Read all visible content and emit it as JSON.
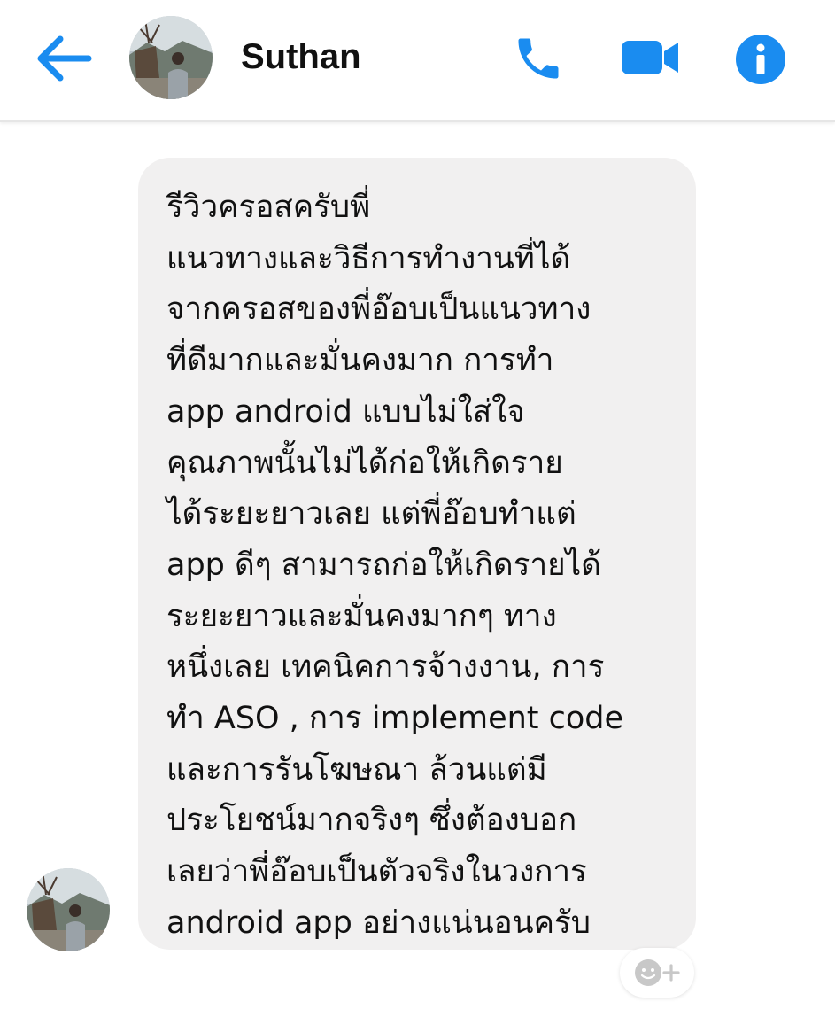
{
  "header": {
    "contact_name": "Suthan",
    "icons": {
      "back": "back-arrow-icon",
      "call": "phone-icon",
      "video": "video-camera-icon",
      "info": "info-icon"
    }
  },
  "message": {
    "lines": [
      "รีวิวครอสครับพี่",
      "แนวทางและวิธีการทำงานที่ได้",
      "จากครอสของพี่อ๊อบเป็นแนวทาง",
      "ที่ดีมากและมั่นคงมาก การทำ",
      "app android แบบไม่ใส่ใจ",
      "คุณภาพนั้นไม่ได้ก่อให้เกิดราย",
      "ได้ระยะยาวเลย แต่พี่อ๊อบทำแต่",
      "app ดีๆ สามารถก่อให้เกิดรายได้",
      "ระยะยาวและมั่นคงมากๆ ทาง",
      "หนึ่งเลย เทคนิคการจ้างงาน, การ",
      "ทำ ASO , การ implement code",
      "และการรันโฆษณา ล้วนแต่มี",
      "ประโยชน์มากจริงๆ ซึ่งต้องบอก",
      "เลยว่าพี่อ๊อบเป็นตัวจริงในวงการ",
      "android app อย่างแน่นอนครับ"
    ]
  },
  "colors": {
    "accent": "#1a8cf0",
    "bubble": "#f1f0f0",
    "text": "#111111"
  },
  "reaction_button": {
    "icon": "add-reaction-icon"
  }
}
